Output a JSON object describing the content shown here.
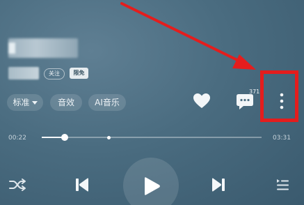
{
  "player": {
    "follow_label": "关注",
    "limited_label": "限免",
    "quality_label": "标准",
    "effect_label": "音效",
    "ai_label": "AI音乐",
    "comment_count": "371",
    "elapsed_time": "00:22",
    "total_time": "03:31",
    "progress_fraction": 0.104
  },
  "annotation": {
    "highlight_color": "#e41d1d",
    "highlight_target": "more-options"
  },
  "icons": {
    "like": "heart-icon",
    "comment": "comment-icon",
    "more": "more-vertical-icon",
    "shuffle": "shuffle-icon",
    "previous": "skip-previous-icon",
    "play": "play-icon",
    "next": "skip-next-icon",
    "playlist": "playlist-icon"
  }
}
